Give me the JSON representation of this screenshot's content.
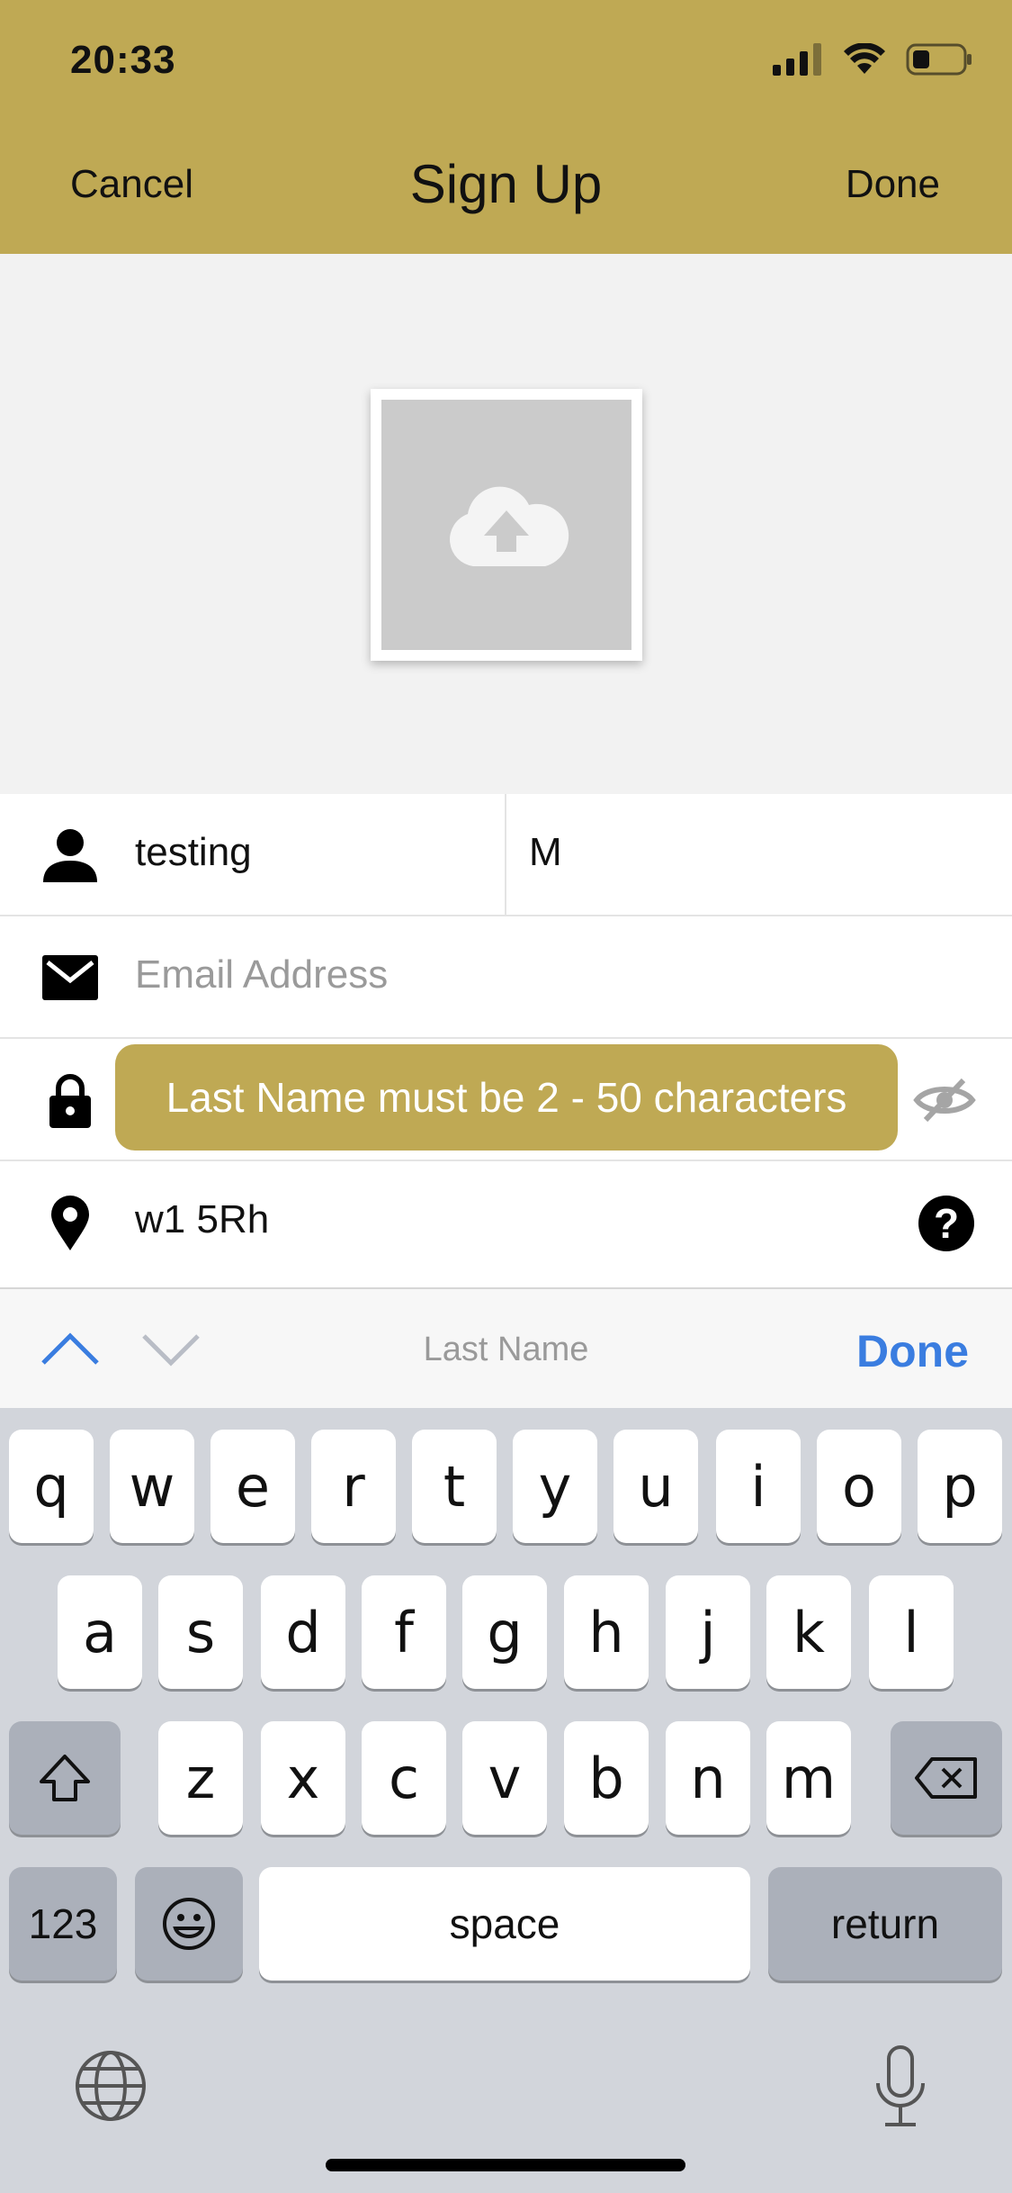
{
  "status": {
    "time": "20:33"
  },
  "nav": {
    "cancel": "Cancel",
    "title": "Sign Up",
    "done": "Done"
  },
  "photo": {
    "icon": "cloud-upload-icon"
  },
  "form": {
    "first_name": "testing",
    "last_name": "M",
    "email_placeholder": "Email Address",
    "toast": "Last Name must be 2 - 50 characters",
    "postcode": "w1 5Rh"
  },
  "toolbar": {
    "label": "Last Name",
    "done": "Done"
  },
  "keyboard": {
    "row1": [
      "q",
      "w",
      "e",
      "r",
      "t",
      "y",
      "u",
      "i",
      "o",
      "p"
    ],
    "row2": [
      "a",
      "s",
      "d",
      "f",
      "g",
      "h",
      "j",
      "k",
      "l"
    ],
    "row3": [
      "z",
      "x",
      "c",
      "v",
      "b",
      "n",
      "m"
    ],
    "numbers": "123",
    "space": "space",
    "return": "return"
  },
  "colors": {
    "accent": "#bfa954",
    "link": "#3a7de0"
  }
}
